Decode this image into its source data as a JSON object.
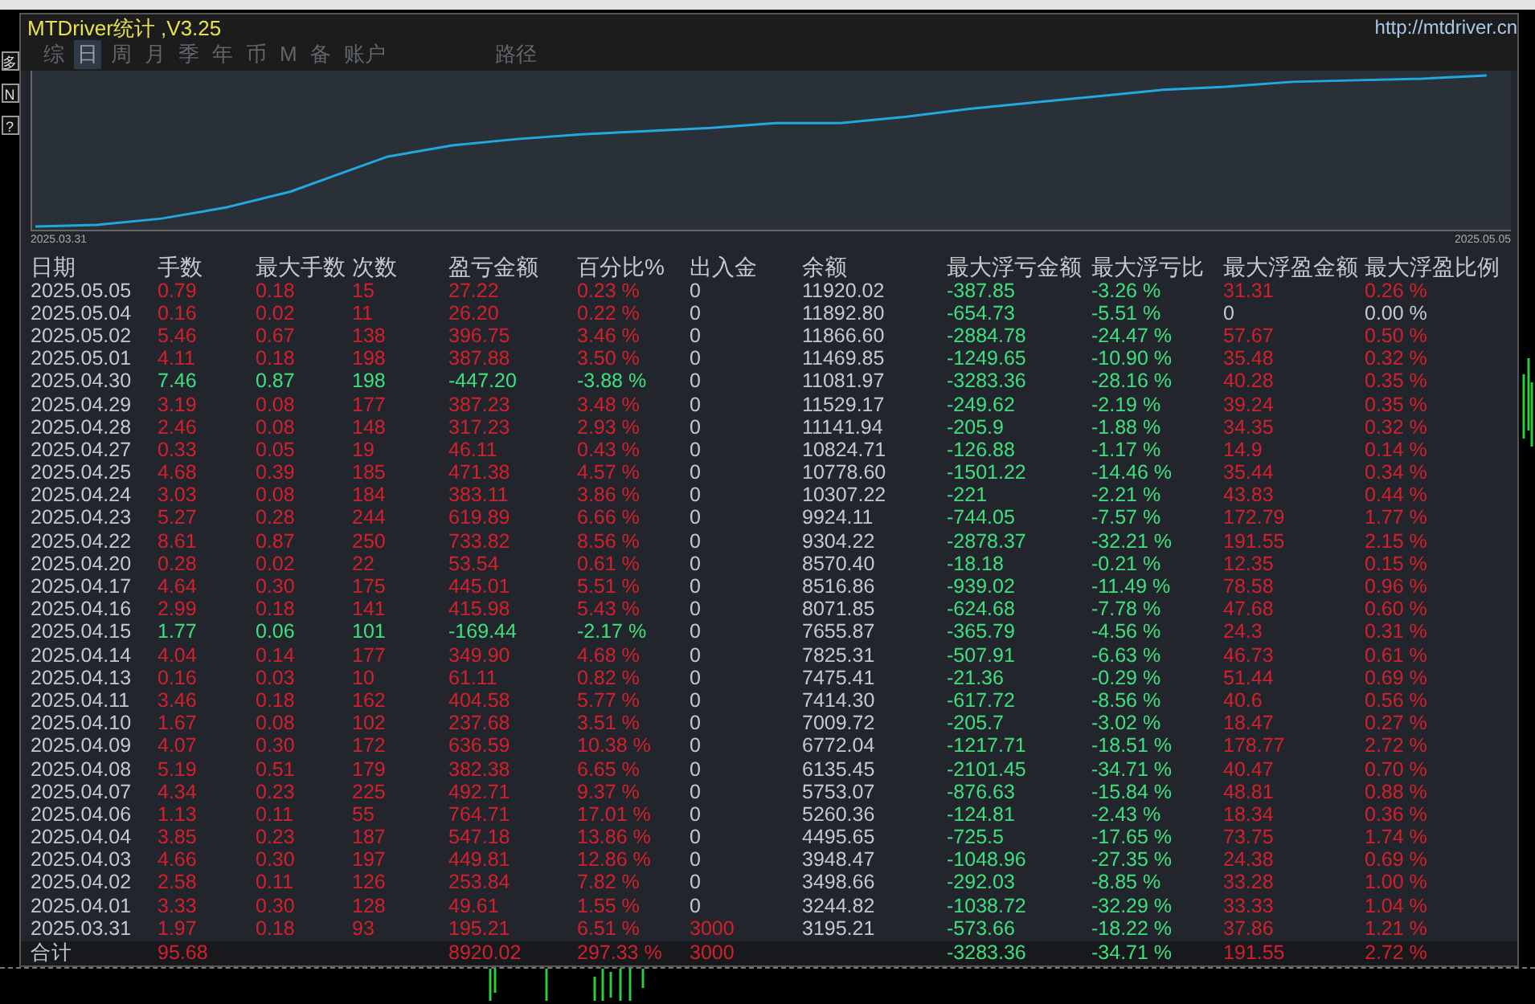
{
  "window": {
    "title": "MTDriver统计 ,V3.25",
    "url": "http://mtdriver.cn"
  },
  "side_buttons": [
    "多",
    "N",
    "?"
  ],
  "tabs": [
    {
      "label": "综",
      "selected": false
    },
    {
      "label": "日",
      "selected": true
    },
    {
      "label": "周",
      "selected": false
    },
    {
      "label": "月",
      "selected": false
    },
    {
      "label": "季",
      "selected": false
    },
    {
      "label": "年",
      "selected": false
    },
    {
      "label": "币",
      "selected": false
    },
    {
      "label": "M",
      "selected": false
    },
    {
      "label": "备",
      "selected": false
    },
    {
      "label": "账户",
      "selected": false
    },
    {
      "label": "路径",
      "selected": false
    }
  ],
  "equity_chart": {
    "start_label": "2025.03.31",
    "end_label": "2025.05.05"
  },
  "table": {
    "columns": [
      "日期",
      "手数",
      "最大手数",
      "次数",
      "盈亏金额",
      "百分比%",
      "出入金",
      "余额",
      "最大浮亏金额",
      "最大浮亏比",
      "最大浮盈金额",
      "最大浮盈比例"
    ],
    "rows": [
      {
        "kind": "gain",
        "funds_in": false,
        "float_gain": true,
        "cells": [
          "2025.05.05",
          "0.79",
          "0.18",
          "15",
          "27.22",
          "0.23 %",
          "0",
          "11920.02",
          "-387.85",
          "-3.26 %",
          "31.31",
          "0.26 %"
        ]
      },
      {
        "kind": "gain",
        "funds_in": false,
        "float_gain": false,
        "cells": [
          "2025.05.04",
          "0.16",
          "0.02",
          "11",
          "26.20",
          "0.22 %",
          "0",
          "11892.80",
          "-654.73",
          "-5.51 %",
          "0",
          "0.00 %"
        ]
      },
      {
        "kind": "gain",
        "funds_in": false,
        "float_gain": true,
        "cells": [
          "2025.05.02",
          "5.46",
          "0.67",
          "138",
          "396.75",
          "3.46 %",
          "0",
          "11866.60",
          "-2884.78",
          "-24.47 %",
          "57.67",
          "0.50 %"
        ]
      },
      {
        "kind": "gain",
        "funds_in": false,
        "float_gain": true,
        "cells": [
          "2025.05.01",
          "4.11",
          "0.18",
          "198",
          "387.88",
          "3.50 %",
          "0",
          "11469.85",
          "-1249.65",
          "-10.90 %",
          "35.48",
          "0.32 %"
        ]
      },
      {
        "kind": "loss",
        "funds_in": false,
        "float_gain": true,
        "cells": [
          "2025.04.30",
          "7.46",
          "0.87",
          "198",
          "-447.20",
          "-3.88 %",
          "0",
          "11081.97",
          "-3283.36",
          "-28.16 %",
          "40.28",
          "0.35 %"
        ]
      },
      {
        "kind": "gain",
        "funds_in": false,
        "float_gain": true,
        "cells": [
          "2025.04.29",
          "3.19",
          "0.08",
          "177",
          "387.23",
          "3.48 %",
          "0",
          "11529.17",
          "-249.62",
          "-2.19 %",
          "39.24",
          "0.35 %"
        ]
      },
      {
        "kind": "gain",
        "funds_in": false,
        "float_gain": true,
        "cells": [
          "2025.04.28",
          "2.46",
          "0.08",
          "148",
          "317.23",
          "2.93 %",
          "0",
          "11141.94",
          "-205.9",
          "-1.88 %",
          "34.35",
          "0.32 %"
        ]
      },
      {
        "kind": "gain",
        "funds_in": false,
        "float_gain": true,
        "cells": [
          "2025.04.27",
          "0.33",
          "0.05",
          "19",
          "46.11",
          "0.43 %",
          "0",
          "10824.71",
          "-126.88",
          "-1.17 %",
          "14.9",
          "0.14 %"
        ]
      },
      {
        "kind": "gain",
        "funds_in": false,
        "float_gain": true,
        "cells": [
          "2025.04.25",
          "4.68",
          "0.39",
          "185",
          "471.38",
          "4.57 %",
          "0",
          "10778.60",
          "-1501.22",
          "-14.46 %",
          "35.44",
          "0.34 %"
        ]
      },
      {
        "kind": "gain",
        "funds_in": false,
        "float_gain": true,
        "cells": [
          "2025.04.24",
          "3.03",
          "0.08",
          "184",
          "383.11",
          "3.86 %",
          "0",
          "10307.22",
          "-221",
          "-2.21 %",
          "43.83",
          "0.44 %"
        ]
      },
      {
        "kind": "gain",
        "funds_in": false,
        "float_gain": true,
        "cells": [
          "2025.04.23",
          "5.27",
          "0.28",
          "244",
          "619.89",
          "6.66 %",
          "0",
          "9924.11",
          "-744.05",
          "-7.57 %",
          "172.79",
          "1.77 %"
        ]
      },
      {
        "kind": "gain",
        "funds_in": false,
        "float_gain": true,
        "cells": [
          "2025.04.22",
          "8.61",
          "0.87",
          "250",
          "733.82",
          "8.56 %",
          "0",
          "9304.22",
          "-2878.37",
          "-32.21 %",
          "191.55",
          "2.15 %"
        ]
      },
      {
        "kind": "gain",
        "funds_in": false,
        "float_gain": true,
        "cells": [
          "2025.04.20",
          "0.28",
          "0.02",
          "22",
          "53.54",
          "0.61 %",
          "0",
          "8570.40",
          "-18.18",
          "-0.21 %",
          "12.35",
          "0.15 %"
        ]
      },
      {
        "kind": "gain",
        "funds_in": false,
        "float_gain": true,
        "cells": [
          "2025.04.17",
          "4.64",
          "0.30",
          "175",
          "445.01",
          "5.51 %",
          "0",
          "8516.86",
          "-939.02",
          "-11.49 %",
          "78.58",
          "0.96 %"
        ]
      },
      {
        "kind": "gain",
        "funds_in": false,
        "float_gain": true,
        "cells": [
          "2025.04.16",
          "2.99",
          "0.18",
          "141",
          "415.98",
          "5.43 %",
          "0",
          "8071.85",
          "-624.68",
          "-7.78 %",
          "47.68",
          "0.60 %"
        ]
      },
      {
        "kind": "loss",
        "funds_in": false,
        "float_gain": true,
        "cells": [
          "2025.04.15",
          "1.77",
          "0.06",
          "101",
          "-169.44",
          "-2.17 %",
          "0",
          "7655.87",
          "-365.79",
          "-4.56 %",
          "24.3",
          "0.31 %"
        ]
      },
      {
        "kind": "gain",
        "funds_in": false,
        "float_gain": true,
        "cells": [
          "2025.04.14",
          "4.04",
          "0.14",
          "177",
          "349.90",
          "4.68 %",
          "0",
          "7825.31",
          "-507.91",
          "-6.63 %",
          "46.73",
          "0.61 %"
        ]
      },
      {
        "kind": "gain",
        "funds_in": false,
        "float_gain": true,
        "cells": [
          "2025.04.13",
          "0.16",
          "0.03",
          "10",
          "61.11",
          "0.82 %",
          "0",
          "7475.41",
          "-21.36",
          "-0.29 %",
          "51.44",
          "0.69 %"
        ]
      },
      {
        "kind": "gain",
        "funds_in": false,
        "float_gain": true,
        "cells": [
          "2025.04.11",
          "3.46",
          "0.18",
          "162",
          "404.58",
          "5.77 %",
          "0",
          "7414.30",
          "-617.72",
          "-8.56 %",
          "40.6",
          "0.56 %"
        ]
      },
      {
        "kind": "gain",
        "funds_in": false,
        "float_gain": true,
        "cells": [
          "2025.04.10",
          "1.67",
          "0.08",
          "102",
          "237.68",
          "3.51 %",
          "0",
          "7009.72",
          "-205.7",
          "-3.02 %",
          "18.47",
          "0.27 %"
        ]
      },
      {
        "kind": "gain",
        "funds_in": false,
        "float_gain": true,
        "cells": [
          "2025.04.09",
          "4.07",
          "0.30",
          "172",
          "636.59",
          "10.38 %",
          "0",
          "6772.04",
          "-1217.71",
          "-18.51 %",
          "178.77",
          "2.72 %"
        ]
      },
      {
        "kind": "gain",
        "funds_in": false,
        "float_gain": true,
        "cells": [
          "2025.04.08",
          "5.19",
          "0.51",
          "179",
          "382.38",
          "6.65 %",
          "0",
          "6135.45",
          "-2101.45",
          "-34.71 %",
          "40.47",
          "0.70 %"
        ]
      },
      {
        "kind": "gain",
        "funds_in": false,
        "float_gain": true,
        "cells": [
          "2025.04.07",
          "4.34",
          "0.23",
          "225",
          "492.71",
          "9.37 %",
          "0",
          "5753.07",
          "-876.63",
          "-15.84 %",
          "48.81",
          "0.88 %"
        ]
      },
      {
        "kind": "gain",
        "funds_in": false,
        "float_gain": true,
        "cells": [
          "2025.04.06",
          "1.13",
          "0.11",
          "55",
          "764.71",
          "17.01 %",
          "0",
          "5260.36",
          "-124.81",
          "-2.43 %",
          "18.34",
          "0.36 %"
        ]
      },
      {
        "kind": "gain",
        "funds_in": false,
        "float_gain": true,
        "cells": [
          "2025.04.04",
          "3.85",
          "0.23",
          "187",
          "547.18",
          "13.86 %",
          "0",
          "4495.65",
          "-725.5",
          "-17.65 %",
          "73.75",
          "1.74 %"
        ]
      },
      {
        "kind": "gain",
        "funds_in": false,
        "float_gain": true,
        "cells": [
          "2025.04.03",
          "4.66",
          "0.30",
          "197",
          "449.81",
          "12.86 %",
          "0",
          "3948.47",
          "-1048.96",
          "-27.35 %",
          "24.38",
          "0.69 %"
        ]
      },
      {
        "kind": "gain",
        "funds_in": false,
        "float_gain": true,
        "cells": [
          "2025.04.02",
          "2.58",
          "0.11",
          "126",
          "253.84",
          "7.82 %",
          "0",
          "3498.66",
          "-292.03",
          "-8.85 %",
          "33.28",
          "1.00 %"
        ]
      },
      {
        "kind": "gain",
        "funds_in": false,
        "float_gain": true,
        "cells": [
          "2025.04.01",
          "3.33",
          "0.30",
          "128",
          "49.61",
          "1.55 %",
          "0",
          "3244.82",
          "-1038.72",
          "-32.29 %",
          "33.33",
          "1.04 %"
        ]
      },
      {
        "kind": "gain",
        "funds_in": true,
        "float_gain": true,
        "cells": [
          "2025.03.31",
          "1.97",
          "0.18",
          "93",
          "195.21",
          "6.51 %",
          "3000",
          "3195.21",
          "-573.66",
          "-18.22 %",
          "37.86",
          "1.21 %"
        ]
      }
    ],
    "total": {
      "label": "合计",
      "lots": "95.68",
      "pnl": "8920.02",
      "pct": "297.33 %",
      "funds": "3000",
      "max_dd": "-3283.36",
      "max_dd_pct": "-34.71 %",
      "max_fp": "191.55",
      "max_fp_pct": "2.72 %"
    }
  }
}
